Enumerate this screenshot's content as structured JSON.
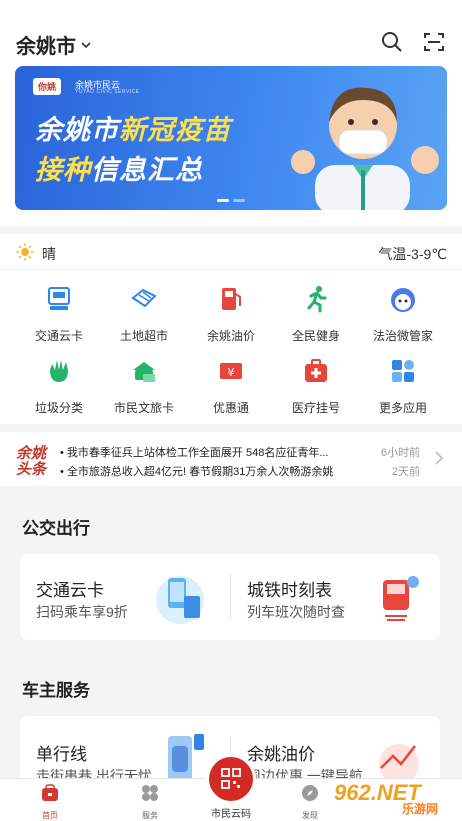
{
  "header": {
    "city": "余姚市",
    "icons": {
      "search": "search-icon",
      "scan": "scan-icon",
      "dropdown": "chevron-down-icon"
    }
  },
  "banner": {
    "logo_text": "你姚",
    "org": "余姚市民云",
    "org_en": "YUYAO CIVIC SERVICE",
    "line1_a": "余姚市",
    "line1_b": "新冠疫苗",
    "line2_a": "接种",
    "line2_b": "信息汇总"
  },
  "weather": {
    "condition": "晴",
    "temperature": "气温-3-9℃"
  },
  "services": [
    {
      "label": "交通云卡",
      "icon": "bus-card-icon",
      "color": "#2f86e8"
    },
    {
      "label": "土地超市",
      "icon": "land-market-icon",
      "color": "#2f86e8"
    },
    {
      "label": "余姚油价",
      "icon": "fuel-pump-icon",
      "color": "#e8453c"
    },
    {
      "label": "全民健身",
      "icon": "running-icon",
      "color": "#23b36b"
    },
    {
      "label": "法治微管家",
      "icon": "mascot-icon",
      "color": "#4a7be8"
    },
    {
      "label": "垃圾分类",
      "icon": "recycle-hand-icon",
      "color": "#23b36b"
    },
    {
      "label": "市民文旅卡",
      "icon": "culture-card-icon",
      "color": "#23b36b"
    },
    {
      "label": "优惠通",
      "icon": "coupon-icon",
      "color": "#e8453c"
    },
    {
      "label": "医疗挂号",
      "icon": "medical-kit-icon",
      "color": "#e8453c"
    },
    {
      "label": "更多应用",
      "icon": "apps-grid-icon",
      "color": "#2f86e8"
    }
  ],
  "news": {
    "brand_a": "余姚",
    "brand_b": "头条",
    "items": [
      {
        "text": "• 我市春季征兵上站体检工作全面展开 548名应征青年...",
        "time": "6小时前"
      },
      {
        "text": "• 全市旅游总收入超4亿元! 春节假期31万余人次畅游余姚",
        "time": "2天前"
      }
    ]
  },
  "transit": {
    "title": "公交出行",
    "cards": [
      {
        "title": "交通云卡",
        "subtitle": "扫码乘车享9折",
        "icon": "phone-bus-card-icon"
      },
      {
        "title": "城铁时刻表",
        "subtitle": "列车班次随时查",
        "icon": "train-icon"
      }
    ]
  },
  "car": {
    "title": "车主服务",
    "cards": [
      {
        "title": "单行线",
        "subtitle": "走街串巷 出行无忧",
        "icon": "car-road-icon"
      },
      {
        "title": "余姚油价",
        "subtitle": "周边优惠 一键导航",
        "icon": "fuel-chart-icon"
      }
    ]
  },
  "tabbar": {
    "tabs": [
      {
        "label": "首页",
        "icon": "home-icon"
      },
      {
        "label": "服务",
        "icon": "services-icon"
      },
      {
        "label": "市民云码",
        "icon": "qr-code-icon"
      },
      {
        "label": "发现",
        "icon": "discover-icon"
      }
    ]
  },
  "watermark": {
    "text": "962.NET",
    "text2": "乐游网"
  },
  "colors": {
    "accent": "#d42a25",
    "primary_blue": "#2f86e8"
  }
}
